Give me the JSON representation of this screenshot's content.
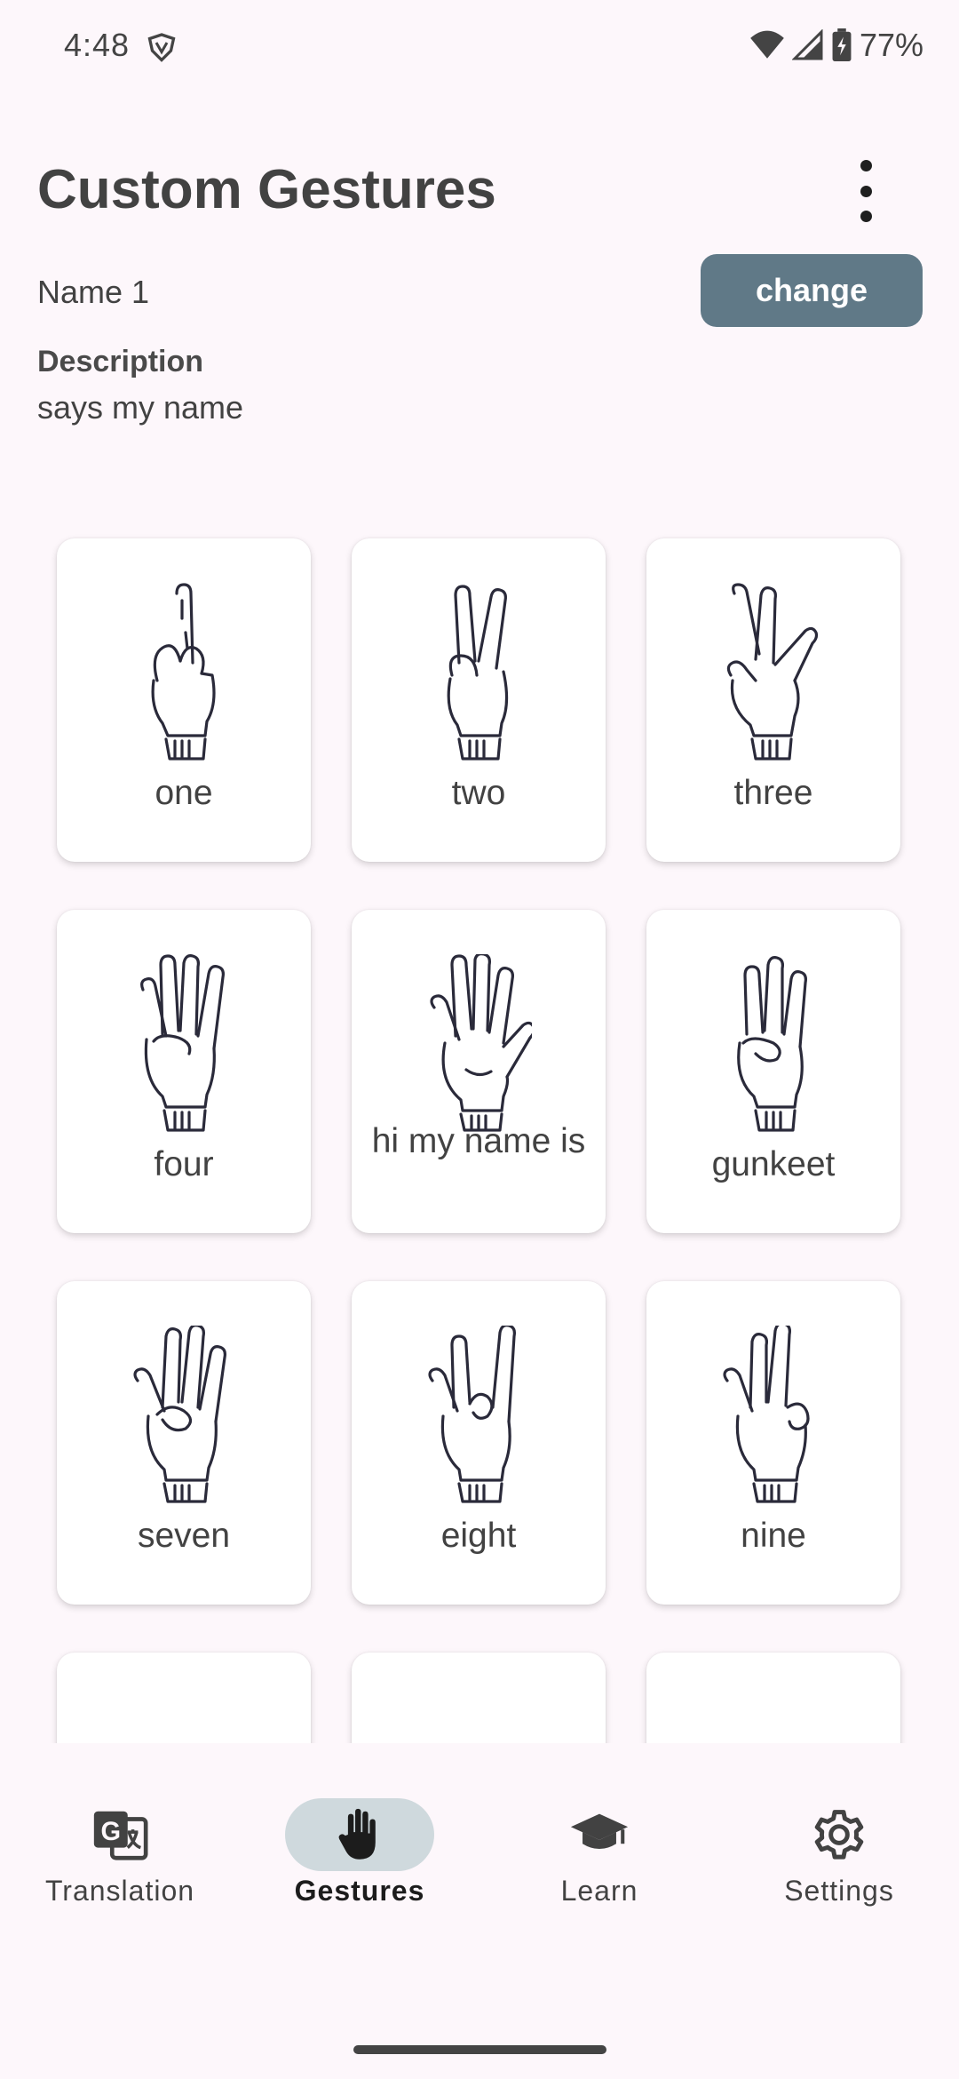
{
  "status_bar": {
    "time": "4:48",
    "battery": "77%"
  },
  "header": {
    "title": "Custom Gestures"
  },
  "gesture": {
    "name": "Name 1",
    "change_label": "change",
    "description_label": "Description",
    "description": "says my name"
  },
  "cards": [
    {
      "label": "one",
      "icon": "one-finger-hand-icon"
    },
    {
      "label": "two",
      "icon": "two-finger-hand-icon"
    },
    {
      "label": "three",
      "icon": "three-finger-hand-icon"
    },
    {
      "label": "four",
      "icon": "four-finger-hand-icon"
    },
    {
      "label": "hi my name is",
      "icon": "open-hand-icon"
    },
    {
      "label": "gunkeet",
      "icon": "crossed-fingers-hand-icon"
    },
    {
      "label": "seven",
      "icon": "seven-hand-icon"
    },
    {
      "label": "eight",
      "icon": "eight-hand-icon"
    },
    {
      "label": "nine",
      "icon": "nine-hand-icon"
    },
    {
      "label": "",
      "icon": "fist-hand-icon"
    },
    {
      "label": "",
      "icon": "pinky-hand-icon"
    },
    {
      "label": "",
      "icon": "point-hand-icon"
    }
  ],
  "nav": [
    {
      "label": "Translation",
      "icon": "translate-icon",
      "active": false
    },
    {
      "label": "Gestures",
      "icon": "hand-icon",
      "active": true
    },
    {
      "label": "Learn",
      "icon": "graduation-cap-icon",
      "active": false
    },
    {
      "label": "Settings",
      "icon": "gear-icon",
      "active": false
    }
  ],
  "colors": {
    "accent": "#607987",
    "active_pill": "#cfd9dd",
    "background": "#fdf7fb"
  }
}
